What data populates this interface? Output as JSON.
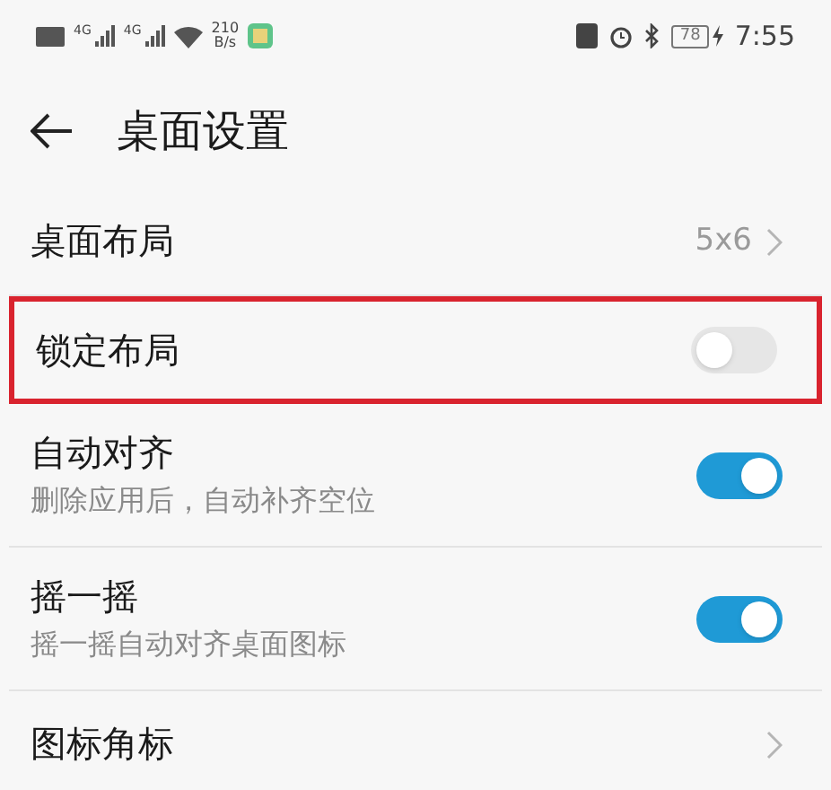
{
  "status_bar": {
    "left_texts": [
      "4G",
      "4G"
    ],
    "speed": [
      "210",
      "B/s"
    ],
    "battery": "78",
    "time": "7:55"
  },
  "header": {
    "title": "桌面设置"
  },
  "rows": [
    {
      "kind": "value",
      "title": "桌面布局",
      "value": "5x6",
      "highlighted": false
    },
    {
      "kind": "toggle",
      "title": "锁定布局",
      "on": false,
      "highlighted": true
    },
    {
      "kind": "toggle",
      "title": "自动对齐",
      "subtitle": "删除应用后，自动补齐空位",
      "on": true,
      "highlighted": false
    },
    {
      "kind": "toggle",
      "title": "摇一摇",
      "subtitle": "摇一摇自动对齐桌面图标",
      "on": true,
      "highlighted": false
    },
    {
      "kind": "chevron",
      "title": "图标角标",
      "highlighted": false
    }
  ]
}
